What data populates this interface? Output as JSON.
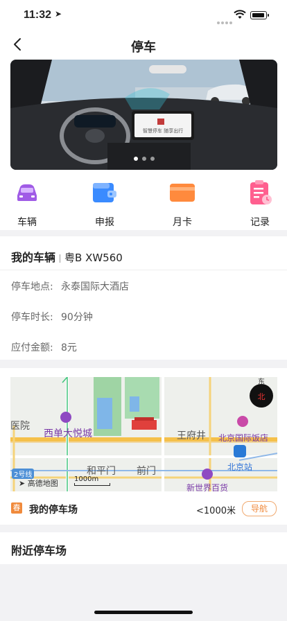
{
  "status_bar": {
    "time": "11:32",
    "location_arrow": "location-arrow-icon"
  },
  "nav": {
    "title": "停车"
  },
  "banner": {
    "dots": 3,
    "active_dot": 0,
    "screen_text": "智慧停车 随享出行"
  },
  "menu": [
    {
      "label": "车辆",
      "icon": "car-icon",
      "color": "#9b5de5"
    },
    {
      "label": "申报",
      "icon": "wallet-icon",
      "color": "#3a86ff"
    },
    {
      "label": "月卡",
      "icon": "card-icon",
      "color": "#ff7b3a"
    },
    {
      "label": "记录",
      "icon": "record-icon",
      "color": "#ef476f"
    }
  ],
  "vehicle": {
    "title": "我的车辆",
    "plate": "粤B XW560",
    "rows": [
      {
        "label": "停车地点:",
        "value": "永泰国际大酒店"
      },
      {
        "label": "停车时长:",
        "value": "90分钟"
      },
      {
        "label": "应付金额:",
        "value": "8元"
      }
    ]
  },
  "map": {
    "labels": {
      "hospital": "医院",
      "xidan": "西单大悦城",
      "wangfujing": "王府井",
      "beijing_hotel": "北京国际饭店",
      "hepingmen": "和平门",
      "qianmen": "前门",
      "beijing_station": "北京站",
      "xinshijie": "新世界百货",
      "logo": "高德地图",
      "line2": "2号线",
      "scale": "1000m",
      "compass_n": "北",
      "compass_e": "东"
    }
  },
  "parking_lot": {
    "icon_char": "春",
    "name": "我的停车场",
    "distance": "<1000米",
    "nav_button": "导航"
  },
  "nearby": {
    "title": "附近停车场"
  },
  "colors": {
    "accent": "#f08a3c",
    "bg": "#f2f2f4"
  }
}
